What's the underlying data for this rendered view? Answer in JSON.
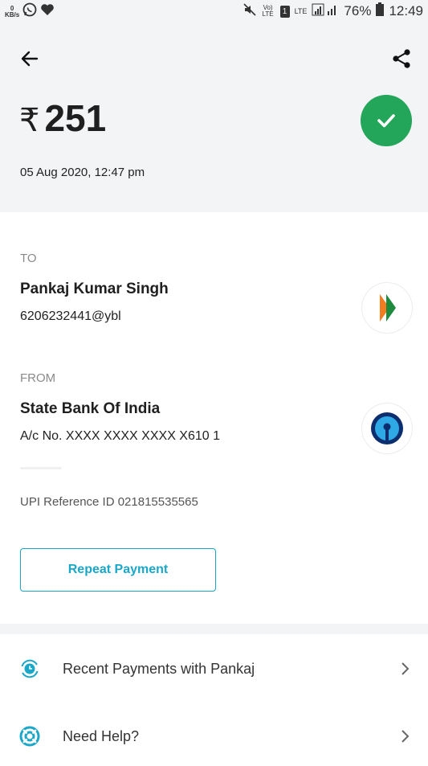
{
  "status_bar": {
    "kbs_value": "0",
    "kbs_unit": "KB/s",
    "volte": "Vo) LTE",
    "sim": "1",
    "network": "LTE",
    "battery": "76%",
    "time": "12:49"
  },
  "transaction": {
    "currency_symbol": "₹",
    "amount": "251",
    "datetime": "05 Aug 2020, 12:47 pm",
    "status_color": "#23a55a"
  },
  "to": {
    "label": "TO",
    "name": "Pankaj Kumar Singh",
    "upi_id": "6206232441@ybl"
  },
  "from": {
    "label": "FROM",
    "bank": "State Bank Of India",
    "account": "A/c No. XXXX XXXX XXXX X610 1"
  },
  "reference": "UPI Reference ID 021815535565",
  "repeat_button": "Repeat Payment",
  "actions": [
    {
      "label": "Recent Payments with Pankaj",
      "icon": "recent-payments-icon"
    },
    {
      "label": "Need Help?",
      "icon": "help-lifebuoy-icon"
    }
  ],
  "colors": {
    "accent": "#1aa7c8",
    "success": "#23a55a",
    "header_bg": "#f3f4f6"
  }
}
